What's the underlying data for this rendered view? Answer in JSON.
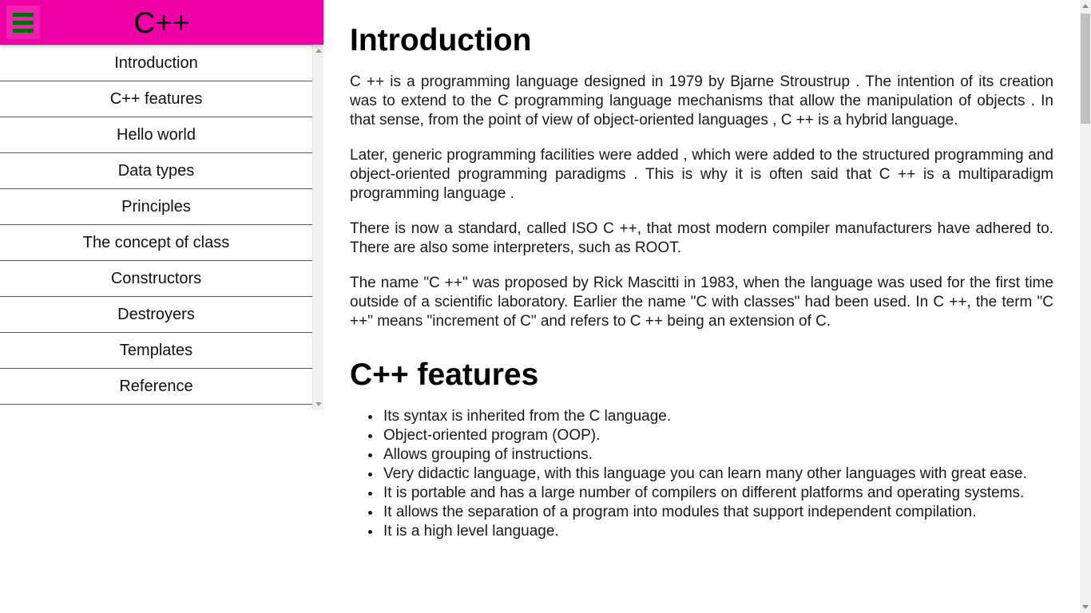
{
  "header": {
    "title": "C++",
    "menu_icon": "hamburger-menu-icon",
    "background_color": "#ed00a6",
    "menu_bar_color": "#046a09"
  },
  "sidebar": {
    "items": [
      {
        "label": "Introduction"
      },
      {
        "label": "C++ features"
      },
      {
        "label": "Hello world"
      },
      {
        "label": "Data types"
      },
      {
        "label": "Principles"
      },
      {
        "label": "The concept of class"
      },
      {
        "label": "Constructors"
      },
      {
        "label": "Destroyers"
      },
      {
        "label": "Templates"
      },
      {
        "label": "Reference"
      }
    ],
    "scrollbar": {
      "up_arrow": "scroll-up-arrow-icon",
      "down_arrow": "scroll-down-arrow-icon"
    }
  },
  "main": {
    "sections": [
      {
        "heading": "Introduction",
        "paragraphs": [
          "C ++ is a programming language designed in 1979 by Bjarne Stroustrup . The intention of its creation was to extend to the C programming language mechanisms that allow the manipulation of objects . In that sense, from the point of view of object-oriented languages , C ++ is a hybrid language.",
          "Later, generic programming facilities were added , which were added to the structured programming and object-oriented programming paradigms . This is why it is often said that C ++ is a multiparadigm programming language .",
          "There is now a standard, called ISO C ++, that most modern compiler manufacturers have adhered to. There are also some interpreters, such as ROOT.",
          "The name \"C ++\" was proposed by Rick Mascitti in 1983, when the language was used for the first time outside of a scientific laboratory. Earlier the name \"C with classes\" had been used. In C ++, the term \"C ++\" means \"increment of C\" and refers to C ++ being an extension of C."
        ]
      },
      {
        "heading": "C++ features",
        "bullets": [
          "Its syntax is inherited from the C language.",
          "Object-oriented program (OOP).",
          "Allows grouping of instructions.",
          "Very didactic language, with this language you can learn many other languages with great ease.",
          "It is portable and has a large number of compilers on different platforms and operating systems.",
          "It allows the separation of a program into modules that support independent compilation.",
          "It is a high level language."
        ]
      }
    ]
  },
  "page_scrollbar": {
    "up_arrow": "scroll-up-arrow-icon",
    "down_arrow": "scroll-down-arrow-icon"
  }
}
